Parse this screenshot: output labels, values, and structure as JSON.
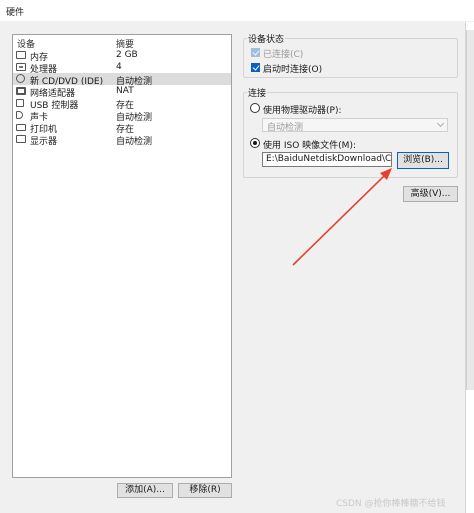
{
  "window": {
    "title": "硬件"
  },
  "devices": {
    "headers": {
      "device": "设备",
      "summary": "摘要"
    },
    "rows": [
      {
        "name": "内存",
        "summary": "2 GB",
        "icon": "memory-icon"
      },
      {
        "name": "处理器",
        "summary": "4",
        "icon": "cpu-icon"
      },
      {
        "name": "新 CD/DVD (IDE)",
        "summary": "自动检测",
        "icon": "cd-dvd-icon",
        "selected": true
      },
      {
        "name": "网络适配器",
        "summary": "NAT",
        "icon": "network-adapter-icon"
      },
      {
        "name": "USB 控制器",
        "summary": "存在",
        "icon": "usb-controller-icon"
      },
      {
        "name": "声卡",
        "summary": "自动检测",
        "icon": "sound-card-icon"
      },
      {
        "name": "打印机",
        "summary": "存在",
        "icon": "printer-icon"
      },
      {
        "name": "显示器",
        "summary": "自动检测",
        "icon": "display-icon"
      }
    ],
    "add_button": "添加(A)...",
    "remove_button": "移除(R)"
  },
  "device_status": {
    "title": "设备状态",
    "connected_label": "已连接(C)",
    "connected_checked": true,
    "connect_on_start_label": "启动时连接(O)",
    "connect_on_start_checked": true
  },
  "connection": {
    "title": "连接",
    "physical_drive_label": "使用物理驱动器(P):",
    "physical_drive_value": "自动检测",
    "iso_label": "使用 ISO 映像文件(M):",
    "iso_path": "E:\\BaiduNetdiskDownload\\Cent",
    "browse_button": "浏览(B)...",
    "selected_option": "iso"
  },
  "advanced_button": "高级(V)...",
  "watermark": "CSDN @抢你棒棒糖不给钱",
  "colors": {
    "annotation_arrow": "#e8402e",
    "selection": "#dcdcdc",
    "checkbox_accent": "#0b5fbe"
  }
}
